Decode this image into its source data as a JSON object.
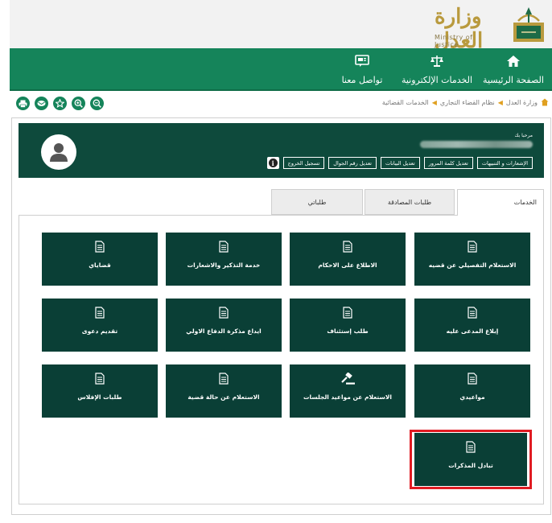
{
  "header": {
    "logo_ar": "وزارة العدل",
    "logo_en": "Ministry of Justice"
  },
  "nav": [
    {
      "label": "الصفحة الرئيسية",
      "icon": "home-icon"
    },
    {
      "label": "الخدمات الإلكترونية",
      "icon": "scales-icon"
    },
    {
      "label": "تواصل معنا",
      "icon": "contact-icon"
    }
  ],
  "tools": [
    "print-icon",
    "mail-icon",
    "star-icon",
    "zoom-in-icon",
    "zoom-out-icon"
  ],
  "breadcrumb": [
    "وزارة العدل",
    "نظام القضاء التجاري",
    "الخدمات القضائية"
  ],
  "profile": {
    "welcome": "مرحبا بك",
    "buttons": [
      "الإشعارات و التنبيهات",
      "تعديل كلمة المرور",
      "تعديل البيانات",
      "تعديل رقم الجوال",
      "تسجيل الخروج"
    ]
  },
  "tabs": {
    "services": "الخدمات",
    "certification": "طلبات المصادقة",
    "mine": "طلباتي"
  },
  "tiles": [
    {
      "label": "الاستعلام التفصيلي عن قضيه",
      "icon": "document-icon"
    },
    {
      "label": "الاطلاع على الاحكام",
      "icon": "document-icon"
    },
    {
      "label": "خدمة التذكير والاشعارات",
      "icon": "document-icon"
    },
    {
      "label": "قضاياي",
      "icon": "document-icon"
    },
    {
      "label": "إبلاغ المدعى عليه",
      "icon": "document-icon"
    },
    {
      "label": "طلب إستئناف",
      "icon": "document-icon"
    },
    {
      "label": "ايداع مذكرة الدفاع الاولي",
      "icon": "document-icon"
    },
    {
      "label": "تقديم دعوى",
      "icon": "document-icon"
    },
    {
      "label": "مواعيدي",
      "icon": "document-icon"
    },
    {
      "label": "الاستعلام عن مواعيد الجلسات",
      "icon": "gavel-icon"
    },
    {
      "label": "الاستعلام عن حالة قضية",
      "icon": "document-icon"
    },
    {
      "label": "طلبات الإفلاس",
      "icon": "document-icon"
    },
    {
      "label": "تبادل المذكرات",
      "icon": "document-icon"
    }
  ],
  "colors": {
    "nav_green": "#15845a",
    "tile_green": "#0a3f36",
    "highlight_red": "#e01b22"
  }
}
